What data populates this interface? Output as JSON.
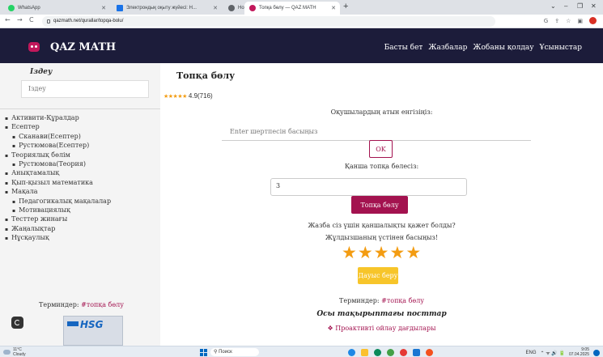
{
  "browser": {
    "tabs": [
      {
        "label": "WhatsApp",
        "active": false
      },
      {
        "label": "Электрондық оқыту жүйесі: H...",
        "active": false
      },
      {
        "label": "Новая вкладка",
        "active": false
      },
      {
        "label": "Топқа бөлу — QAZ MATH",
        "active": true
      }
    ],
    "url": "qazmath.net/qurallar/topqa-bolu/",
    "new_tab": "+",
    "window_controls": {
      "collapse": "⌄",
      "minimize": "–",
      "restore": "❐",
      "close": "✕"
    },
    "nav": {
      "back": "←",
      "forward": "→",
      "reload": "C"
    },
    "toolbar_icons": {
      "google": "G",
      "share": "⇪",
      "bookmark": "☆",
      "sidebar": "▣"
    }
  },
  "site": {
    "brand": "QAZ MATH",
    "nav": [
      "Басты бет",
      "Жазбалар",
      "Жобаны қолдау",
      "Ұсыныстар"
    ]
  },
  "sidebar": {
    "search_heading": "Іздеу",
    "search_placeholder": "Іздеу",
    "items": [
      {
        "label": "Активити-Құралдар",
        "sub": false
      },
      {
        "label": "Есептер",
        "sub": false
      },
      {
        "label": "Сканави(Есептер)",
        "sub": true
      },
      {
        "label": "Рустюмова(Есептер)",
        "sub": true
      },
      {
        "label": "Теориялық бөлім",
        "sub": false
      },
      {
        "label": "Рустюмова(Теория)",
        "sub": true
      },
      {
        "label": "Анықтамалық",
        "sub": false
      },
      {
        "label": "Қып-қызыл математика",
        "sub": false
      },
      {
        "label": "Мақала",
        "sub": false
      },
      {
        "label": "Педагогикалық мақалалар",
        "sub": true
      },
      {
        "label": "Мотивациялық",
        "sub": true
      },
      {
        "label": "Тесттер жинағы",
        "sub": false
      },
      {
        "label": "Жаңалықтар",
        "sub": false
      },
      {
        "label": "Нұсқаулық",
        "sub": false
      }
    ],
    "tags_label": "Терминдер:",
    "tag": "#топқа бөлу",
    "card_brand": "HSG"
  },
  "main": {
    "title": "Топқа бөлу",
    "rating": {
      "stars": "★★★★★",
      "value": "4.9(716)"
    },
    "names_prompt": "Оқушылардың атын енгізіңіз:",
    "names_placeholder": "Enter шертпесін басыңыз",
    "ok_label": "OK",
    "groups_prompt": "Қанша топқа бөлесіз:",
    "groups_value": "3",
    "split_label": "Топқа бөлу",
    "feedback_q1": "Жазба сіз үшін қаншалықты қажет болды?",
    "feedback_q2": "Жұлдызшаның үстінен басыңыз!",
    "stars_count": 5,
    "vote_label": "Дауыс беру",
    "tags_label": "Терминдер:",
    "tag": "#топқа бөлу",
    "related_title": "Осы тақырыптағы посттар",
    "related_link": "❖ Проактивті ойлау дағдылары"
  },
  "taskbar": {
    "temp": "11°C",
    "weather": "Cloudy",
    "search": "Поиск",
    "lang": "ENG",
    "tray_icons": "⌃ ᯤ 🔊 🔋",
    "time": "9:05",
    "date": "07.04.2025"
  },
  "colors": {
    "accent": "#a3124f",
    "header": "#1c1c3a",
    "star": "#f39c12",
    "vote": "#f7c52a"
  }
}
